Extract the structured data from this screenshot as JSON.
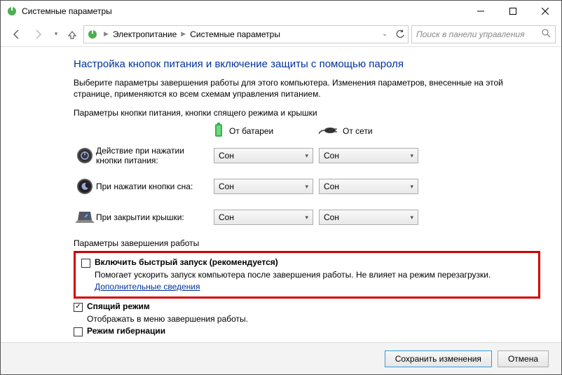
{
  "window": {
    "title": "Системные параметры"
  },
  "breadcrumb": {
    "item1": "Электропитание",
    "item2": "Системные параметры"
  },
  "search": {
    "placeholder": "Поиск в панели управления"
  },
  "page": {
    "title": "Настройка кнопок питания и включение защиты с помощью пароля",
    "intro": "Выберите параметры завершения работы для этого компьютера. Изменения параметров, внесенные на этой странице, применяются ко всем схемам управления питанием."
  },
  "button_section": {
    "header": "Параметры кнопки питания, кнопки спящего режима и крышки",
    "col_battery": "От батареи",
    "col_ac": "От сети",
    "rows": [
      {
        "label": "Действие при нажатии кнопки питания:",
        "battery": "Сон",
        "ac": "Сон"
      },
      {
        "label": "При нажатии кнопки сна:",
        "battery": "Сон",
        "ac": "Сон"
      },
      {
        "label": "При закрытии крышки:",
        "battery": "Сон",
        "ac": "Сон"
      }
    ]
  },
  "shutdown_section": {
    "header": "Параметры завершения работы",
    "fast_startup": {
      "label": "Включить быстрый запуск (рекомендуется)",
      "desc_pre": "Помогает ускорить запуск компьютера после завершения работы. Не влияет на режим перезагрузки. ",
      "link": "Дополнительные сведения"
    },
    "sleep": {
      "label": "Спящий режим",
      "desc": "Отображать в меню завершения работы."
    },
    "hibernate": {
      "label": "Режим гибернации"
    }
  },
  "footer": {
    "save": "Сохранить изменения",
    "cancel": "Отмена"
  }
}
